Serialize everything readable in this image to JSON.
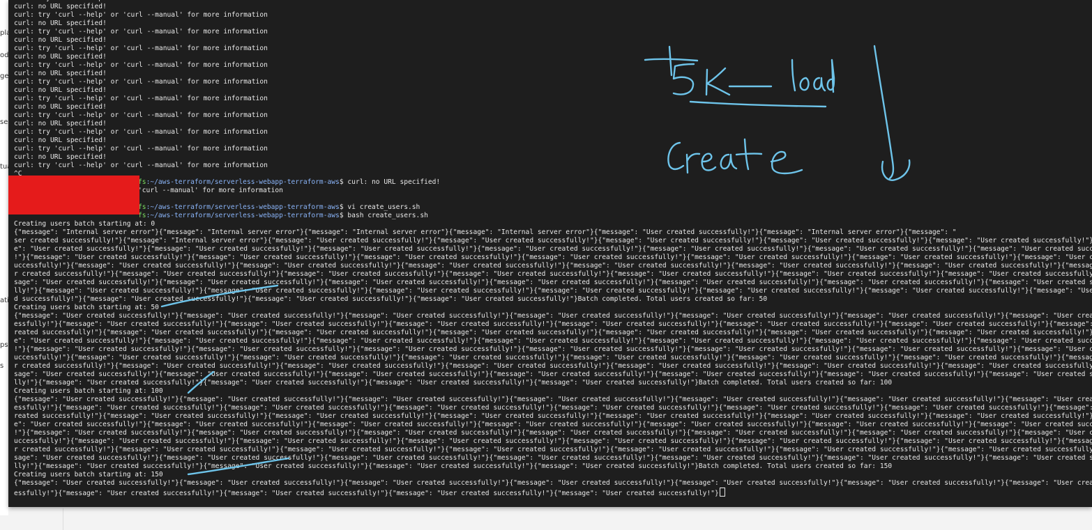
{
  "background": {
    "fragments": [
      "pla",
      "ode",
      "ges",
      "se",
      "tua",
      "atio",
      "ps",
      "s"
    ]
  },
  "terminal": {
    "lines": [
      "curl: try 'curl --help' or 'curl --manual' for more information",
      "curl: no URL specified!",
      "curl: try 'curl --help' or 'curl --manual' for more information",
      "curl: no URL specified!",
      "curl: try 'curl --help' or 'curl --manual' for more information",
      "curl: no URL specified!",
      "curl: try 'curl --help' or 'curl --manual' for more information",
      "curl: no URL specified!",
      "curl: try 'curl --help' or 'curl --manual' for more information",
      "curl: no URL specified!",
      "curl: try 'curl --help' or 'curl --manual' for more information",
      "curl: no URL specified!",
      "curl: try 'curl --help' or 'curl --manual' for more information",
      "curl: no URL specified!",
      "curl: try 'curl --help' or 'curl --manual' for more information",
      "curl: no URL specified!",
      "curl: try 'curl --help' or 'curl --manual' for more information",
      "curl: no URL specified!",
      "curl: try 'curl --help' or 'curl --manual' for more information",
      "curl: no URL specified!",
      "curl: try 'curl --help' or 'curl --manual' for more information",
      "^C",
      {
        "prompt_user": "",
        "prompt_host_tail": "fs",
        "path": ":~/aws-terraform/serverless-webapp-terraform-aws",
        "cmd": "$ curl: no URL specified!"
      },
      "'curl --manual' for more information",
      "",
      {
        "prompt_user": "",
        "prompt_host_tail": "fs",
        "path": ":~/aws-terraform/serverless-webapp-terraform-aws",
        "cmd": "$ vi create_users.sh"
      },
      {
        "prompt_user": "",
        "prompt_host_tail": "fs",
        "path": ":~/aws-terraform/serverless-webapp-terraform-aws",
        "cmd": "$ bash create_users.sh"
      },
      "Creating users batch starting at: 0",
      "{\"message\": \"Internal server error\"}{\"message\": \"Internal server error\"}{\"message\": \"Internal server error\"}{\"message\": \"Internal server error\"}{\"message\": \"User created successfully!\"}{\"message\": \"Internal server error\"}{\"message\": \"",
      "ser created successfully!\"}{\"message\": \"Internal server error\"}{\"message\": \"User created successfully!\"}{\"message\": \"User created successfully!\"}{\"message\": \"User created successfully!\"}{\"message\": \"User created successfully!\"}{\"message\": \"User created successfully!\"}{\"messa",
      "e\": \"User created successfully!\"}{\"message\": \"User created successfully!\"}{\"message\": \"User created successfully!\"}{\"message\": \"User created successfully!\"}{\"message\": \"User created successfully!\"}{\"message\": \"User created successfully!\"}{\"message\": \"User created successfu",
      "!\"}{\"message\": \"User created successfully!\"}{\"message\": \"User created successfully!\"}{\"message\": \"User created successfully!\"}{\"message\": \"User created successfully!\"}{\"message\": \"User created successfully!\"}{\"message\": \"User created successfully!\"}{\"message\": \"User created",
      "uccessfully!\"}{\"message\": \"User created successfully!\"}{\"message\": \"User created successfully!\"}{\"message\": \"User created successfully!\"}{\"message\": \"User created successfully!\"}{\"message\": \"User created successfully!\"}{\"message\": \"User created successfully!\"}{\"message\": \"Us",
      "r created successfully!\"}{\"message\": \"User created successfully!\"}{\"message\": \"User created successfully!\"}{\"message\": \"User created successfully!\"}{\"message\": \"User created successfully!\"}{\"message\": \"User created successfully!\"}{\"message\": \"User created successfully!\"}{\"messa",
      "sage\": \"User created successfully!\"}{\"message\": \"User created successfully!\"}{\"message\": \"User created successfully!\"}{\"message\": \"User created successfully!\"}{\"message\": \"User created successfully!\"}{\"message\": \"User created successfully!\"}{\"message\": \"User created successf",
      "lly!\"}{\"message\": \"User created successfully!\"}{\"message\": \"User created successfully!\"}{\"message\": \"User created successfully!\"}{\"message\": \"User created successfully!\"}{\"message\": \"User created successfully!\"}{\"message\": \"User created successfully!\"}{\"message\": \"User cr",
      "d successfully!\"}{\"message\": \"User created successfully!\"}{\"message\": \"User created successfully!\"}{\"message\": \"User created successfully!\"}Batch completed. Total users created so far: 50",
      "Creating users batch starting at: 50",
      "{\"message\": \"User created successfully!\"}{\"message\": \"User created successfully!\"}{\"message\": \"User created successfully!\"}{\"message\": \"User created successfully!\"}{\"message\": \"User created successfully!\"}{\"message\": \"User created successfully!\"}{\"message\": \"User created suc",
      "essfully!\"}{\"message\": \"User created successfully!\"}{\"message\": \"User created successfully!\"}{\"message\": \"User created successfully!\"}{\"message\": \"User created successfully!\"}{\"message\": \"User created successfully!\"}{\"message\": \"User created successfully!\"}{\"message\": \"User c",
      "reated successfully!\"}{\"message\": \"User created successfully!\"}{\"message\": \"User created successfully!\"}{\"message\": \"User created successfully!\"}{\"message\": \"User created successfully!\"}{\"message\": \"User created successfully!\"}{\"message\": \"User created successfully!\"}{\"messa",
      "e\": \"User created successfully!\"}{\"message\": \"User created successfully!\"}{\"message\": \"User created successfully!\"}{\"message\": \"User created successfully!\"}{\"message\": \"User created successfully!\"}{\"message\": \"User created successfully!\"}{\"message\": \"User created successfu",
      "!\"}{\"message\": \"User created successfully!\"}{\"message\": \"User created successfully!\"}{\"message\": \"User created successfully!\"}{\"message\": \"User created successfully!\"}{\"message\": \"User created successfully!\"}{\"message\": \"User created successfully!\"}{\"message\": \"User created",
      "uccessfully!\"}{\"message\": \"User created successfully!\"}{\"message\": \"User created successfully!\"}{\"message\": \"User created successfully!\"}{\"message\": \"User created successfully!\"}{\"message\": \"User created successfully!\"}{\"message\": \"User created successfully!\"}{\"message\": \"Us",
      "r created successfully!\"}{\"message\": \"User created successfully!\"}{\"message\": \"User created successfully!\"}{\"message\": \"User created successfully!\"}{\"message\": \"User created successfully!\"}{\"message\": \"User created successfully!\"}{\"message\": \"User created successfully!\"}{\"messa",
      "sage\": \"User created successfully!\"}{\"message\": \"User created successfully!\"}{\"message\": \"User created successfully!\"}{\"message\": \"User created successfully!\"}{\"message\": \"User created successfully!\"}{\"message\": \"User created successfully!\"}{\"message\": \"User created successf",
      "lly!\"}{\"message\": \"User created successfully!\"}{\"message\": \"User created successfully!\"}{\"message\": \"User created successfully!\"}{\"message\": \"User created successfully!\"}Batch completed. Total users created so far: 100",
      "Creating users batch starting at: 100",
      "{\"message\": \"User created successfully!\"}{\"message\": \"User created successfully!\"}{\"message\": \"User created successfully!\"}{\"message\": \"User created successfully!\"}{\"message\": \"User created successfully!\"}{\"message\": \"User created successfully!\"}{\"message\": \"User created suc",
      "essfully!\"}{\"message\": \"User created successfully!\"}{\"message\": \"User created successfully!\"}{\"message\": \"User created successfully!\"}{\"message\": \"User created successfully!\"}{\"message\": \"User created successfully!\"}{\"message\": \"User created successfully!\"}{\"message\": \"User c",
      "reated successfully!\"}{\"message\": \"User created successfully!\"}{\"message\": \"User created successfully!\"}{\"message\": \"User created successfully!\"}{\"message\": \"User created successfully!\"}{\"message\": \"User created successfully!\"}{\"message\": \"User created successfully!\"}{\"messa",
      "e\": \"User created successfully!\"}{\"message\": \"User created successfully!\"}{\"message\": \"User created successfully!\"}{\"message\": \"User created successfully!\"}{\"message\": \"User created successfully!\"}{\"message\": \"User created successfully!\"}{\"message\": \"User created successfu",
      "!\"}{\"message\": \"User created successfully!\"}{\"message\": \"User created successfully!\"}{\"message\": \"User created successfully!\"}{\"message\": \"User created successfully!\"}{\"message\": \"User created successfully!\"}{\"message\": \"User created successfully!\"}{\"message\": \"User created",
      "uccessfully!\"}{\"message\": \"User created successfully!\"}{\"message\": \"User created successfully!\"}{\"message\": \"User created successfully!\"}{\"message\": \"User created successfully!\"}{\"message\": \"User created successfully!\"}{\"message\": \"User created successfully!\"}{\"message\": \"Us",
      "r created successfully!\"}{\"message\": \"User created successfully!\"}{\"message\": \"User created successfully!\"}{\"message\": \"User created successfully!\"}{\"message\": \"User created successfully!\"}{\"message\": \"User created successfully!\"}{\"message\": \"User created successfully!\"}{\"messa",
      "sage\": \"User created successfully!\"}{\"message\": \"User created successfully!\"}{\"message\": \"User created successfully!\"}{\"message\": \"User created successfully!\"}{\"message\": \"User created successfully!\"}{\"message\": \"User created successfully!\"}{\"message\": \"User created successf",
      "lly!\"}{\"message\": \"User created successfully!\"}{\"message\": \"User created successfully!\"}{\"message\": \"User created successfully!\"}{\"message\": \"User created successfully!\"}Batch completed. Total users created so far: 150",
      "Creating users batch starting at: 150",
      "{\"message\": \"User created successfully!\"}{\"message\": \"User created successfully!\"}{\"message\": \"User created successfully!\"}{\"message\": \"User created successfully!\"}{\"message\": \"User created successfully!\"}{\"message\": \"User created successfully!\"}{\"message\": \"User created suc",
      "essfully!\"}{\"message\": \"User created successfully!\"}{\"message\": \"User created successfully!\"}{\"message\": \"User created successfully!\"}{\"message\": \"User created successfully!\"}"
    ]
  },
  "annotation": {
    "text_line1": "+5K— load",
    "text_line2": "create",
    "color": "#6ec4ea"
  },
  "colors": {
    "terminal_bg": "#1e1e1e",
    "terminal_fg": "#e8e8e8",
    "prompt_user": "#7cdc62",
    "prompt_path": "#8ab4f8",
    "redaction": "#e51b1b",
    "ink": "#6ec4ea"
  }
}
